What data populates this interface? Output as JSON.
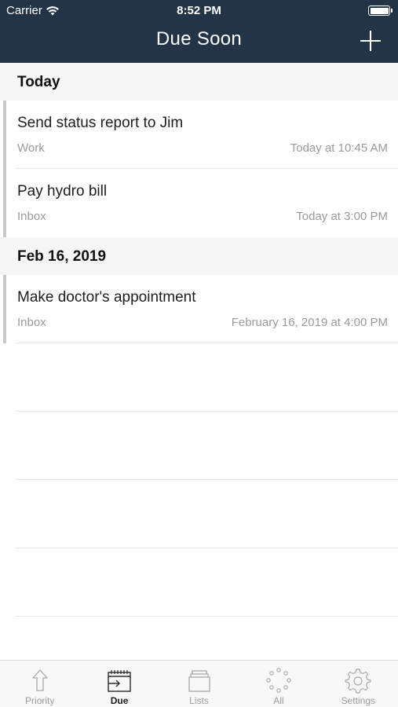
{
  "status_bar": {
    "carrier": "Carrier",
    "time": "8:52 PM"
  },
  "nav": {
    "title": "Due Soon"
  },
  "sections": [
    {
      "header": "Today",
      "tasks": [
        {
          "title": "Send status report to Jim",
          "list": "Work",
          "due": "Today at 10:45 AM"
        },
        {
          "title": "Pay hydro bill",
          "list": "Inbox",
          "due": "Today at 3:00 PM"
        }
      ]
    },
    {
      "header": "Feb 16, 2019",
      "tasks": [
        {
          "title": "Make doctor's appointment",
          "list": "Inbox",
          "due": "February 16, 2019 at 4:00 PM"
        }
      ]
    }
  ],
  "tabs": [
    {
      "label": "Priority",
      "icon": "arrow-up-icon",
      "active": false
    },
    {
      "label": "Due",
      "icon": "calendar-icon",
      "active": true
    },
    {
      "label": "Lists",
      "icon": "stack-icon",
      "active": false
    },
    {
      "label": "All",
      "icon": "dots-circle-icon",
      "active": false
    },
    {
      "label": "Settings",
      "icon": "gear-icon",
      "active": false
    }
  ],
  "colors": {
    "nav_bg": "#243447",
    "accent_bar": "#c8c8c8",
    "section_bg": "#f6f6f6"
  }
}
